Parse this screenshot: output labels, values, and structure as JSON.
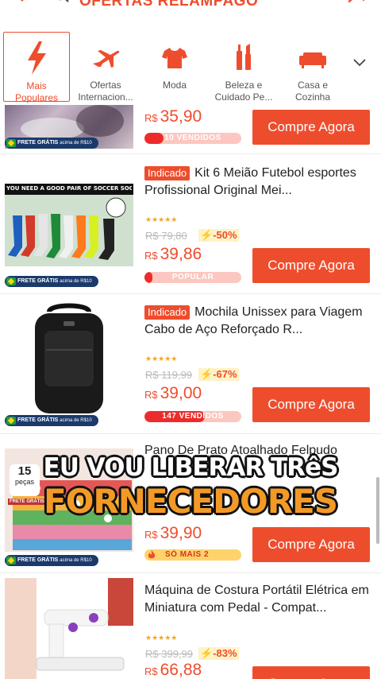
{
  "header": {
    "title": "OFERTAS RELÂMPAGO"
  },
  "categories": [
    {
      "label": "Mais\nPopulares",
      "icon": "flash-icon",
      "active": true
    },
    {
      "label": "Ofertas\nInternacion...",
      "icon": "airplane-icon",
      "active": false
    },
    {
      "label": "Moda",
      "icon": "tshirt-icon",
      "active": false
    },
    {
      "label": "Beleza e\nCuidado Pe...",
      "icon": "beauty-icon",
      "active": false
    },
    {
      "label": "Casa e\nCozinha",
      "icon": "sofa-icon",
      "active": false
    }
  ],
  "frete": {
    "main": "FRETE GRÁTIS",
    "small": "acima de R$10"
  },
  "badge_label": "Indicado",
  "buy_label": "Compre Agora",
  "currency": "R$",
  "products": [
    {
      "title": "",
      "orig_price": "",
      "discount": "",
      "price": "35,90",
      "sold_text": "10 VENDIDOS",
      "sold_fill": 0.2
    },
    {
      "title": "Kit 6 Meião Futebol esportes Profissional Original Mei...",
      "indicado": true,
      "orig_price": "R$ 79,80",
      "discount": "-50%",
      "price": "39,86",
      "sold_text": "POPULAR",
      "sold_fill": 0.08
    },
    {
      "title": "Mochila Unissex para Viagem  Cabo de Aço Reforçado R...",
      "indicado": true,
      "orig_price": "R$ 119,99",
      "discount": "-67%",
      "price": "39,00",
      "sold_text": "147 VENDIDOS",
      "sold_fill": 0.62
    },
    {
      "title": "Pano De Prato Atoalhado  Felpudo",
      "orig_price": "",
      "discount": "",
      "price": "39,90",
      "sold_text": "SÓ MAIS 2",
      "sold_fill": 0.97
    },
    {
      "title": "Máquina de Costura Portátil Elétrica em Miniatura com Pedal - Compat...",
      "orig_price": "R$ 399,99",
      "discount": "-83%",
      "price": "66,88",
      "sold_text": "",
      "sold_fill": 0
    }
  ],
  "thumb_texts": {
    "socks_banner": "YOU NEED A GOOD PAIR OF SOCCER SOCKS",
    "pano_badge_num": "15",
    "pano_badge_unit": "peças",
    "pano_tag": "FRETE GRÁTIS"
  },
  "overlay": {
    "line1": "EU VOU LIBERAR TRêS",
    "line2": "FORNECEDORES"
  },
  "colors": {
    "accent": "#ee4d2d",
    "frete_bg": "#1b3a6b",
    "stars": "#f5a623"
  }
}
